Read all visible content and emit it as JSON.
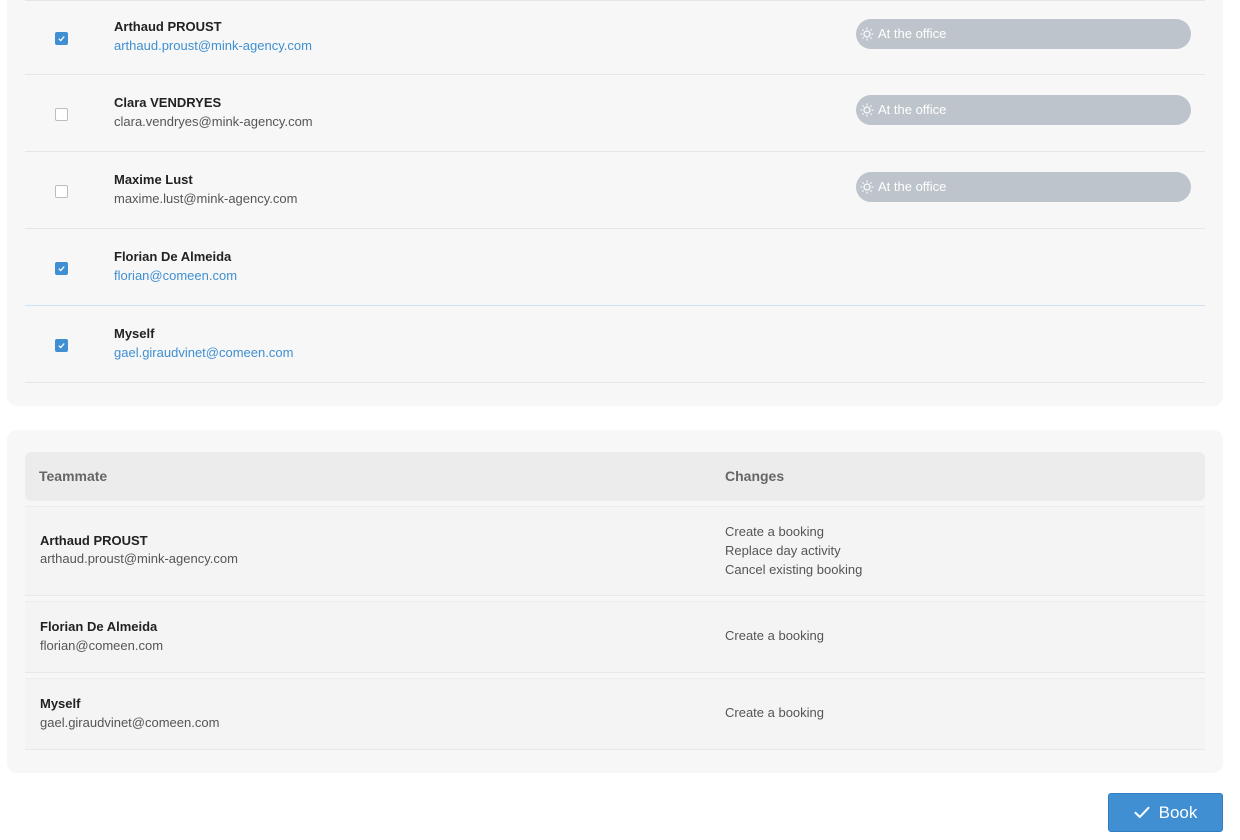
{
  "teammates": [
    {
      "name": "Arthaud PROUST",
      "email": "arthaud.proust@mink-agency.com",
      "checked": true,
      "status": "At the office",
      "status_icon": "sun-icon"
    },
    {
      "name": "Clara VENDRYES",
      "email": "clara.vendryes@mink-agency.com",
      "checked": false,
      "status": "At the office",
      "status_icon": "sun-icon"
    },
    {
      "name": "Maxime Lust",
      "email": "maxime.lust@mink-agency.com",
      "checked": false,
      "status": "At the office",
      "status_icon": "sun-icon"
    },
    {
      "name": "Florian De Almeida",
      "email": "florian@comeen.com",
      "checked": true,
      "status": "",
      "status_icon": ""
    },
    {
      "name": "Myself",
      "email": "gael.giraudvinet@comeen.com",
      "checked": true,
      "status": "",
      "status_icon": ""
    }
  ],
  "changes_table": {
    "headers": {
      "teammate": "Teammate",
      "changes": "Changes"
    },
    "rows": [
      {
        "name": "Arthaud PROUST",
        "email": "arthaud.proust@mink-agency.com",
        "changes": [
          "Create a booking",
          "Replace day activity",
          "Cancel existing booking"
        ]
      },
      {
        "name": "Florian De Almeida",
        "email": "florian@comeen.com",
        "changes": [
          "Create a booking"
        ]
      },
      {
        "name": "Myself",
        "email": "gael.giraudvinet@comeen.com",
        "changes": [
          "Create a booking"
        ]
      }
    ]
  },
  "book_button": {
    "label": "Book",
    "icon": "check-icon"
  },
  "colors": {
    "accent": "#3f8fd2",
    "status_pill": "#bec4cc",
    "card_bg": "#f7f7f7"
  }
}
